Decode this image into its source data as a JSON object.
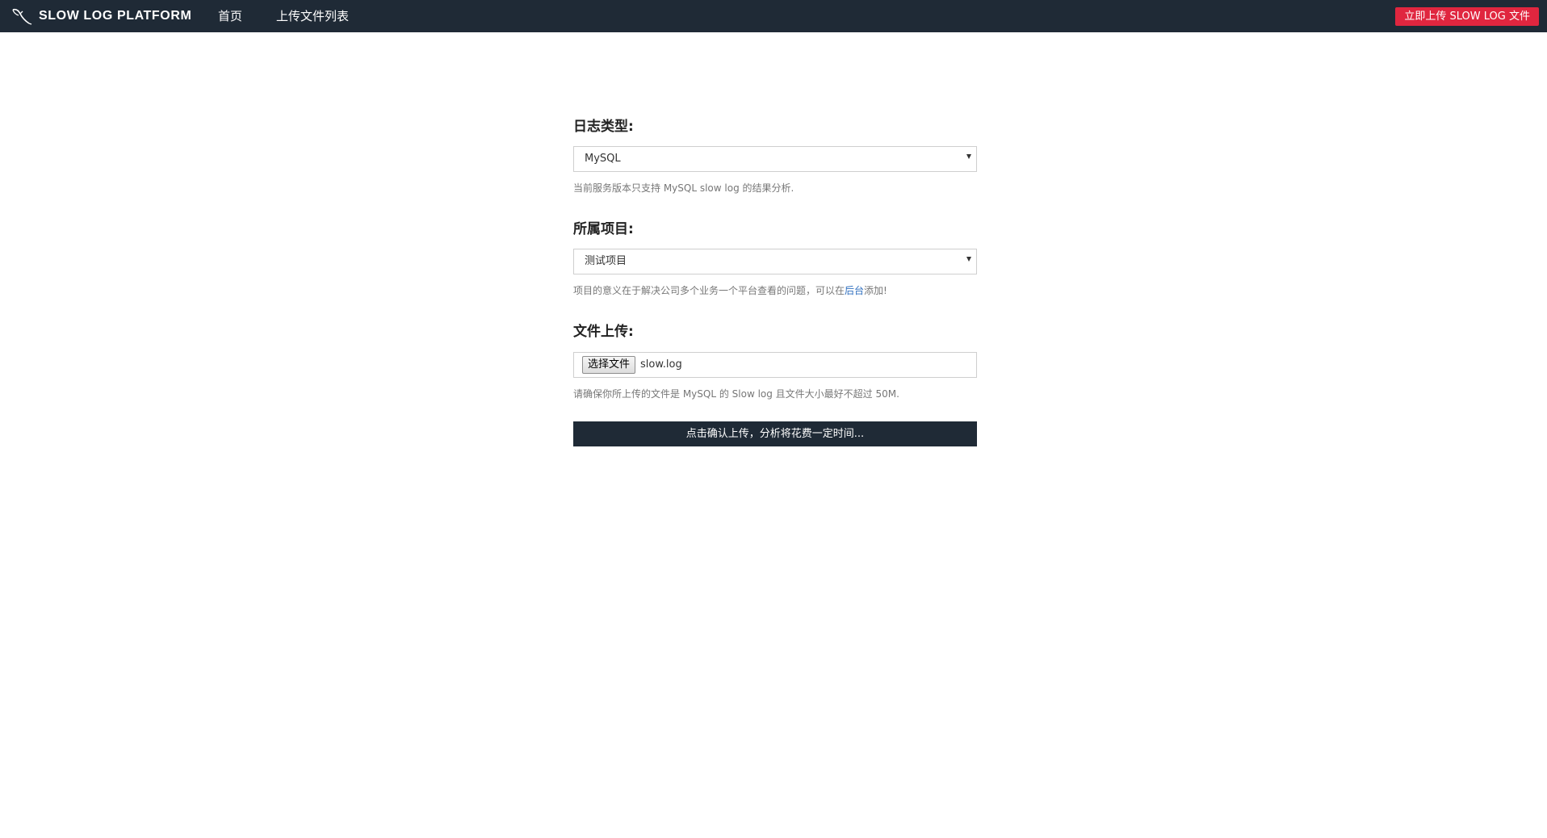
{
  "navbar": {
    "brand_icon": "mysql-dolphin-icon",
    "brand": "SLOW LOG PLATFORM",
    "links": [
      {
        "label": "首页"
      },
      {
        "label": "上传文件列表"
      }
    ],
    "upload_button": "立即上传 SLOW LOG 文件",
    "colors": {
      "background": "#1f2a36",
      "upload_button": "#e0263f"
    }
  },
  "form": {
    "log_type": {
      "label": "日志类型:",
      "selected": "MySQL",
      "help": "当前服务版本只支持 MySQL slow log 的结果分析."
    },
    "project": {
      "label": "所属项目:",
      "selected": "测试项目",
      "help_before": "项目的意义在于解决公司多个业务一个平台查看的问题，可以在",
      "help_link": "后台",
      "help_after": "添加!"
    },
    "file_upload": {
      "label": "文件上传:",
      "button": "选择文件",
      "filename": "slow.log",
      "help": "请确保你所上传的文件是 MySQL 的 Slow log 且文件大小最好不超过 50M."
    },
    "submit": "点击确认上传，分析将花费一定时间..."
  }
}
